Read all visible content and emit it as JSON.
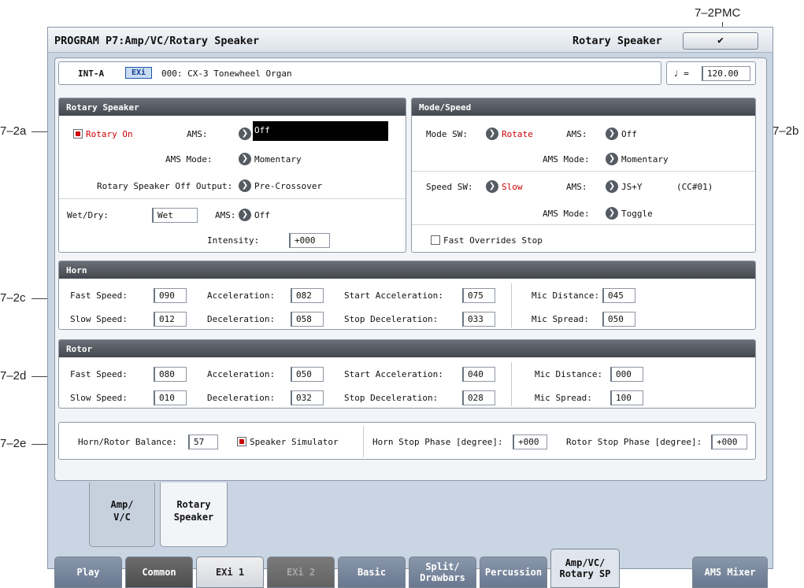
{
  "callouts": {
    "pmc": "7–2PMC",
    "a": "7–2a",
    "b": "7–2b",
    "c": "7–2c",
    "d": "7–2d",
    "e": "7–2e"
  },
  "title": "PROGRAM P7:Amp/VC/Rotary Speaker",
  "page_name": "Rotary Speaker",
  "menu_icon": "✔",
  "program": {
    "bank": "INT-A",
    "type": "EXi",
    "name": "000: CX-3 Tonewheel Organ",
    "tempo_symbol": "♩ =",
    "tempo": "120.00"
  },
  "rotary": {
    "header": "Rotary Speaker",
    "rotary_on": "Rotary On",
    "ams_label": "AMS:",
    "ams_value": "Off",
    "ams_mode_label": "AMS Mode:",
    "ams_mode_value": "Momentary",
    "off_output_label": "Rotary Speaker Off Output:",
    "off_output_value": "Pre-Crossover",
    "wetdry_label": "Wet/Dry:",
    "wetdry_value": "Wet",
    "wd_ams_label": "AMS:",
    "wd_ams_value": "Off",
    "intensity_label": "Intensity:",
    "intensity_value": "+000"
  },
  "mode": {
    "header": "Mode/Speed",
    "mode_sw_label": "Mode SW:",
    "mode_sw_value": "Rotate",
    "ams_label": "AMS:",
    "ams_value": "Off",
    "ams_mode_label": "AMS Mode:",
    "ams_mode_value": "Momentary",
    "speed_sw_label": "Speed SW:",
    "speed_sw_value": "Slow",
    "ams2_label": "AMS:",
    "ams2_value": "JS+Y",
    "ams2_cc": "(CC#01)",
    "ams_mode2_label": "AMS Mode:",
    "ams_mode2_value": "Toggle",
    "fast_overrides": "Fast Overrides Stop"
  },
  "horn": {
    "header": "Horn",
    "fast_speed_label": "Fast Speed:",
    "fast_speed": "090",
    "accel_label": "Acceleration:",
    "accel": "082",
    "start_accel_label": "Start Acceleration:",
    "start_accel": "075",
    "mic_dist_label": "Mic Distance:",
    "mic_dist": "045",
    "slow_speed_label": "Slow Speed:",
    "slow_speed": "012",
    "decel_label": "Deceleration:",
    "decel": "058",
    "stop_decel_label": "Stop Deceleration:",
    "stop_decel": "033",
    "mic_spread_label": "Mic Spread:",
    "mic_spread": "050"
  },
  "rotor": {
    "header": "Rotor",
    "fast_speed_label": "Fast Speed:",
    "fast_speed": "080",
    "accel_label": "Acceleration:",
    "accel": "050",
    "start_accel_label": "Start Acceleration:",
    "start_accel": "040",
    "mic_dist_label": "Mic Distance:",
    "mic_dist": "000",
    "slow_speed_label": "Slow Speed:",
    "slow_speed": "010",
    "decel_label": "Deceleration:",
    "decel": "032",
    "stop_decel_label": "Stop Deceleration:",
    "stop_decel": "028",
    "mic_spread_label": "Mic Spread:",
    "mic_spread": "100"
  },
  "bottom": {
    "balance_label": "Horn/Rotor Balance:",
    "balance": "57",
    "speaker_sim": "Speaker Simulator",
    "horn_phase_label": "Horn Stop Phase [degree]:",
    "horn_phase": "+000",
    "rotor_phase_label": "Rotor Stop Phase [degree]:",
    "rotor_phase": "+000"
  },
  "page_tabs": [
    {
      "l1": "Amp/",
      "l2": "V/C"
    },
    {
      "l1": "Rotary",
      "l2": "Speaker"
    }
  ],
  "bottom_tabs": [
    {
      "l1": "Play",
      "l2": ""
    },
    {
      "l1": "Common",
      "l2": ""
    },
    {
      "l1": "EXi 1",
      "l2": ""
    },
    {
      "l1": "EXi 2",
      "l2": ""
    },
    {
      "l1": "Basic",
      "l2": ""
    },
    {
      "l1": "Split/",
      "l2": "Drawbars"
    },
    {
      "l1": "Percussion",
      "l2": ""
    },
    {
      "l1": "Amp/VC/",
      "l2": "Rotary SP"
    },
    {
      "l1": "AMS Mixer",
      "l2": ""
    }
  ],
  "arrow_glyph": "❯"
}
